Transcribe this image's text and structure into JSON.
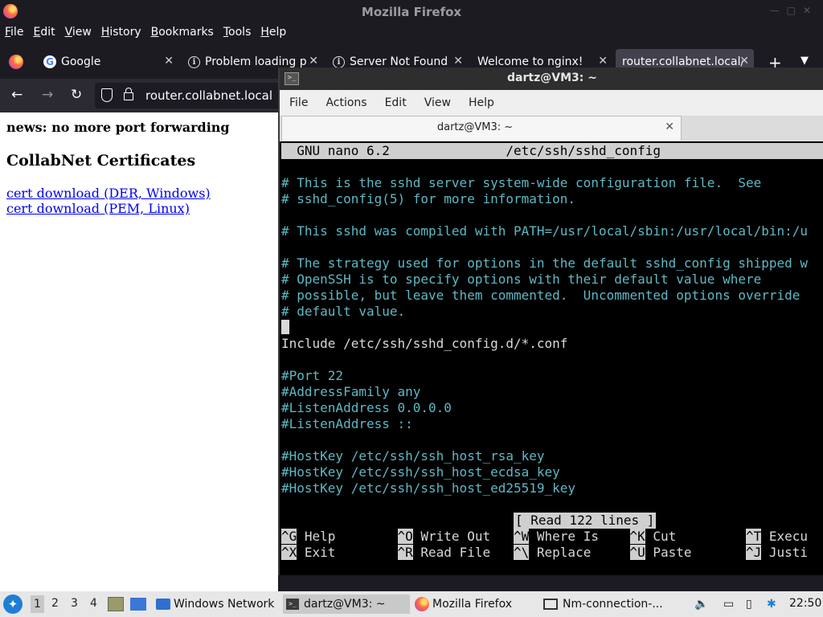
{
  "firefox": {
    "window_title": "Mozilla Firefox",
    "menu": [
      "File",
      "Edit",
      "View",
      "History",
      "Bookmarks",
      "Tools",
      "Help"
    ],
    "tabs": [
      {
        "label": "Google",
        "icon": "google-icon"
      },
      {
        "label": "Problem loading p",
        "icon": "info-icon"
      },
      {
        "label": "Server Not Found",
        "icon": "info-icon"
      },
      {
        "label": "Welcome to nginx!",
        "icon": "none"
      },
      {
        "label": "router.collabnet.local/",
        "icon": "none",
        "active": true
      }
    ],
    "url": {
      "host": "router.",
      "domain": "collabnet.local"
    },
    "page": {
      "news": "news: no more port forwarding",
      "heading": "CollabNet Certificates",
      "links": [
        "cert download (DER, Windows)",
        "cert download (PEM, Linux)"
      ]
    }
  },
  "terminal": {
    "window_title": "dartz@VM3: ~",
    "menu": [
      "File",
      "Actions",
      "Edit",
      "View",
      "Help"
    ],
    "tab_label": "dartz@VM3: ~",
    "nano": {
      "header": "  GNU nano 6.2               /etc/ssh/sshd_config",
      "lines": [
        {
          "text": "",
          "kind": "plain"
        },
        {
          "text": "# This is the sshd server system-wide configuration file.  See",
          "kind": "cmt"
        },
        {
          "text": "# sshd_config(5) for more information.",
          "kind": "cmt"
        },
        {
          "text": "",
          "kind": "plain"
        },
        {
          "text": "# This sshd was compiled with PATH=/usr/local/sbin:/usr/local/bin:/u",
          "kind": "cmt"
        },
        {
          "text": "",
          "kind": "plain"
        },
        {
          "text": "# The strategy used for options in the default sshd_config shipped w",
          "kind": "cmt"
        },
        {
          "text": "# OpenSSH is to specify options with their default value where",
          "kind": "cmt"
        },
        {
          "text": "# possible, but leave them commented.  Uncommented options override",
          "kind": "cmt"
        },
        {
          "text": "# default value.",
          "kind": "cmt"
        },
        {
          "text": "",
          "kind": "plain"
        },
        {
          "text": "Include /etc/ssh/sshd_config.d/*.conf",
          "kind": "plain"
        },
        {
          "text": "",
          "kind": "plain"
        },
        {
          "text": "#Port 22",
          "kind": "cmt"
        },
        {
          "text": "#AddressFamily any",
          "kind": "cmt"
        },
        {
          "text": "#ListenAddress 0.0.0.0",
          "kind": "cmt"
        },
        {
          "text": "#ListenAddress ::",
          "kind": "cmt"
        },
        {
          "text": "",
          "kind": "plain"
        },
        {
          "text": "#HostKey /etc/ssh/ssh_host_rsa_key",
          "kind": "cmt"
        },
        {
          "text": "#HostKey /etc/ssh/ssh_host_ecdsa_key",
          "kind": "cmt"
        },
        {
          "text": "#HostKey /etc/ssh/ssh_host_ed25519_key",
          "kind": "cmt"
        }
      ],
      "status": "[ Read 122 lines ]",
      "shortcuts_row1": [
        {
          "key": "^G",
          "label": " Help        "
        },
        {
          "key": "^O",
          "label": " Write Out   "
        },
        {
          "key": "^W",
          "label": " Where Is    "
        },
        {
          "key": "^K",
          "label": " Cut         "
        },
        {
          "key": "^T",
          "label": " Execu"
        }
      ],
      "shortcuts_row2": [
        {
          "key": "^X",
          "label": " Exit        "
        },
        {
          "key": "^R",
          "label": " Read File   "
        },
        {
          "key": "^\\",
          "label": " Replace     "
        },
        {
          "key": "^U",
          "label": " Paste       "
        },
        {
          "key": "^J",
          "label": " Justi"
        }
      ]
    }
  },
  "taskbar": {
    "workspaces": [
      "1",
      "2",
      "3",
      "4"
    ],
    "items": [
      {
        "label": "Windows Network"
      },
      {
        "label": "dartz@VM3: ~"
      },
      {
        "label": "Mozilla Firefox"
      },
      {
        "label": "Nm-connection-..."
      }
    ],
    "clock": "22:50"
  }
}
